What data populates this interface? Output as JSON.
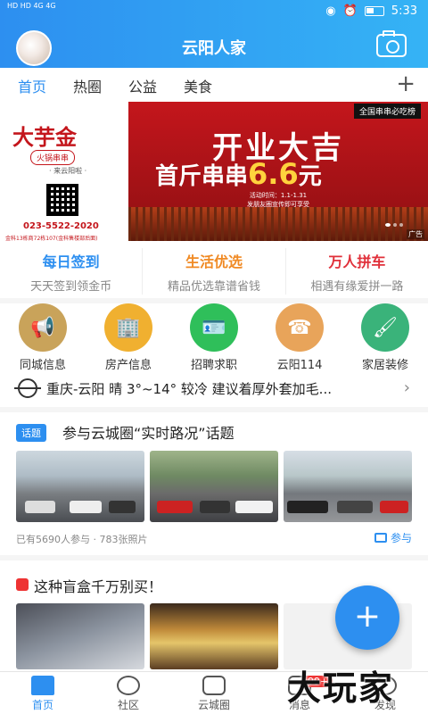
{
  "status_bar": {
    "left_labels": "HD HD 4G 4G",
    "time": "5:33"
  },
  "header": {
    "title": "云阳人家"
  },
  "tabs": [
    {
      "label": "首页",
      "active": true
    },
    {
      "label": "热圈"
    },
    {
      "label": "公益"
    },
    {
      "label": "美食"
    }
  ],
  "banner": {
    "brand": "大芋金",
    "brand_sub": "火锅串串",
    "brand_small": "· 来云阳啦 ·",
    "phone": "023-5522-2020",
    "address": "金科13栋商72栋107(金科售楼部后面)",
    "tag": "全国串串必吃榜",
    "line1": "开业大吉",
    "line2_prefix": "首斤串串",
    "line2_price": "6.6",
    "line2_suffix": "元",
    "note1": "活动时间：1.1-1.31",
    "note2": "发朋友圈宣传即可享受",
    "ad_label": "广告"
  },
  "promos": [
    {
      "title": "每日签到",
      "sub": "天天签到领金币",
      "color": "#2d8ff0"
    },
    {
      "title": "生活优选",
      "sub": "精品优选靠谱省钱",
      "color": "#f08a24"
    },
    {
      "title": "万人拼车",
      "sub": "相遇有缘爱拼一路",
      "color": "#e0303a"
    }
  ],
  "grid": [
    {
      "label": "同城信息",
      "icon": "megaphone-icon",
      "glyph": "📢",
      "color": "#c9a35a"
    },
    {
      "label": "房产信息",
      "icon": "building-icon",
      "glyph": "🏢",
      "color": "#f0b030"
    },
    {
      "label": "招聘求职",
      "icon": "id-card-icon",
      "glyph": "🪪",
      "color": "#2fbf5a"
    },
    {
      "label": "云阳114",
      "icon": "phone-114-icon",
      "glyph": "☎",
      "color": "#e8a45a"
    },
    {
      "label": "家居装修",
      "icon": "paint-roller-icon",
      "glyph": "🖌",
      "color": "#3ab37a"
    }
  ],
  "weather": {
    "text": "重庆-云阳 晴 3°~14° 较冷 建议着厚外套加毛..."
  },
  "topic": {
    "tag": "话题",
    "title": "参与云城圈“实时路况”话题",
    "stats": "已有5690人参与 · 783张照片",
    "join": "参与"
  },
  "post": {
    "title": "这种盲盒千万别买！"
  },
  "bottom_nav": [
    {
      "label": "首页",
      "active": true
    },
    {
      "label": "社区"
    },
    {
      "label": "云城圈"
    },
    {
      "label": "消息",
      "badge": "99+"
    },
    {
      "label": "发现"
    }
  ],
  "watermark": "大玩家"
}
